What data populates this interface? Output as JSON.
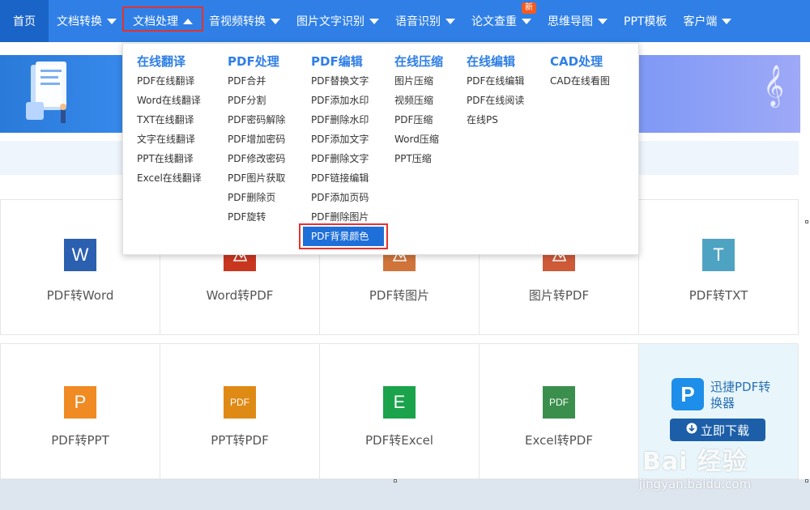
{
  "nav": {
    "items": [
      {
        "label": "首页",
        "has_caret": false
      },
      {
        "label": "文档转换",
        "has_caret": true
      },
      {
        "label": "文档处理",
        "has_caret": true,
        "active": true
      },
      {
        "label": "音视频转换",
        "has_caret": true
      },
      {
        "label": "图片文字识别",
        "has_caret": true
      },
      {
        "label": "语音识别",
        "has_caret": true
      },
      {
        "label": "论文查重",
        "has_caret": true,
        "badge": "新"
      },
      {
        "label": "思维导图",
        "has_caret": true
      },
      {
        "label": "PPT模板",
        "has_caret": false
      },
      {
        "label": "客户端",
        "has_caret": true
      }
    ]
  },
  "dropdown": {
    "columns": [
      {
        "head": "在线翻译",
        "items": [
          "PDF在线翻译",
          "Word在线翻译",
          "TXT在线翻译",
          "文字在线翻译",
          "PPT在线翻译",
          "Excel在线翻译"
        ]
      },
      {
        "head": "PDF处理",
        "items": [
          "PDF合并",
          "PDF分割",
          "PDF密码解除",
          "PDF增加密码",
          "PDF修改密码",
          "PDF图片获取",
          "PDF删除页",
          "PDF旋转"
        ]
      },
      {
        "head": "PDF编辑",
        "items": [
          "PDF替换文字",
          "PDF添加水印",
          "PDF删除水印",
          "PDF添加文字",
          "PDF删除文字",
          "PDF链接编辑",
          "PDF添加页码",
          "PDF删除图片",
          "PDF背景颜色"
        ],
        "selected_index": 8
      },
      {
        "head": "在线压缩",
        "items": [
          "图片压缩",
          "视频压缩",
          "PDF压缩",
          "Word压缩",
          "PPT压缩"
        ]
      },
      {
        "head": "在线编辑",
        "items": [
          "PDF在线编辑",
          "PDF在线阅读",
          "在线PS"
        ]
      },
      {
        "head": "CAD处理",
        "items": [
          "CAD在线看图"
        ]
      }
    ]
  },
  "tiles_row1": [
    {
      "label": "PDF转Word",
      "icon": "W",
      "icon_name": "word-icon",
      "color": "#2b5fb0"
    },
    {
      "label": "Word转PDF",
      "icon": "",
      "icon_name": "pdf-icon",
      "color": "#c9361f"
    },
    {
      "label": "PDF转图片",
      "icon": "",
      "icon_name": "image-icon",
      "color": "#d0743a"
    },
    {
      "label": "图片转PDF",
      "icon": "",
      "icon_name": "pdf-icon",
      "color": "#cf5a38"
    },
    {
      "label": "PDF转TXT",
      "icon": "T",
      "icon_name": "txt-icon",
      "color": "#4fa3c2"
    }
  ],
  "tiles_row2": [
    {
      "label": "PDF转PPT",
      "icon": "P",
      "icon_name": "ppt-icon",
      "color": "#f08a23"
    },
    {
      "label": "PPT转PDF",
      "icon": "PDF",
      "icon_name": "pdf-icon",
      "color": "#e08a16"
    },
    {
      "label": "PDF转Excel",
      "icon": "E",
      "icon_name": "excel-icon",
      "color": "#1aa34a"
    },
    {
      "label": "Excel转PDF",
      "icon": "PDF",
      "icon_name": "pdf-icon",
      "color": "#3a8f4d"
    }
  ],
  "promo": {
    "logo": "P",
    "title": "迅捷PDF转换器",
    "button": "立即下载"
  },
  "watermark": {
    "main": "Bai 经验",
    "sub": "jingyan.baidu.com"
  }
}
